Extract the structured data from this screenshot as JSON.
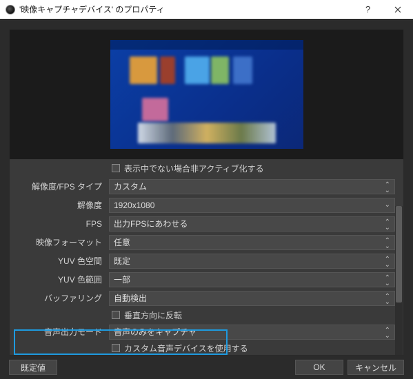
{
  "titlebar": {
    "title": "'映像キャプチャデバイス' のプロパティ"
  },
  "form": {
    "deactivate_when_not_showing": "表示中でない場合非アクティブ化する",
    "resolution_fps_type": {
      "label": "解像度/FPS タイプ",
      "value": "カスタム"
    },
    "resolution": {
      "label": "解像度",
      "value": "1920x1080"
    },
    "fps": {
      "label": "FPS",
      "value": "出力FPSにあわせる"
    },
    "video_format": {
      "label": "映像フォーマット",
      "value": "任意"
    },
    "yuv_color_space": {
      "label": "YUV 色空間",
      "value": "既定"
    },
    "yuv_color_range": {
      "label": "YUV 色範囲",
      "value": "一部"
    },
    "buffering": {
      "label": "バッファリング",
      "value": "自動検出"
    },
    "flip_vertical": "垂直方向に反転",
    "audio_output_mode": {
      "label": "音声出力モード",
      "value": "音声のみをキャプチャ"
    },
    "use_custom_audio_device": "カスタム音声デバイスを使用する"
  },
  "buttons": {
    "defaults": "既定値",
    "ok": "OK",
    "cancel": "キャンセル"
  }
}
